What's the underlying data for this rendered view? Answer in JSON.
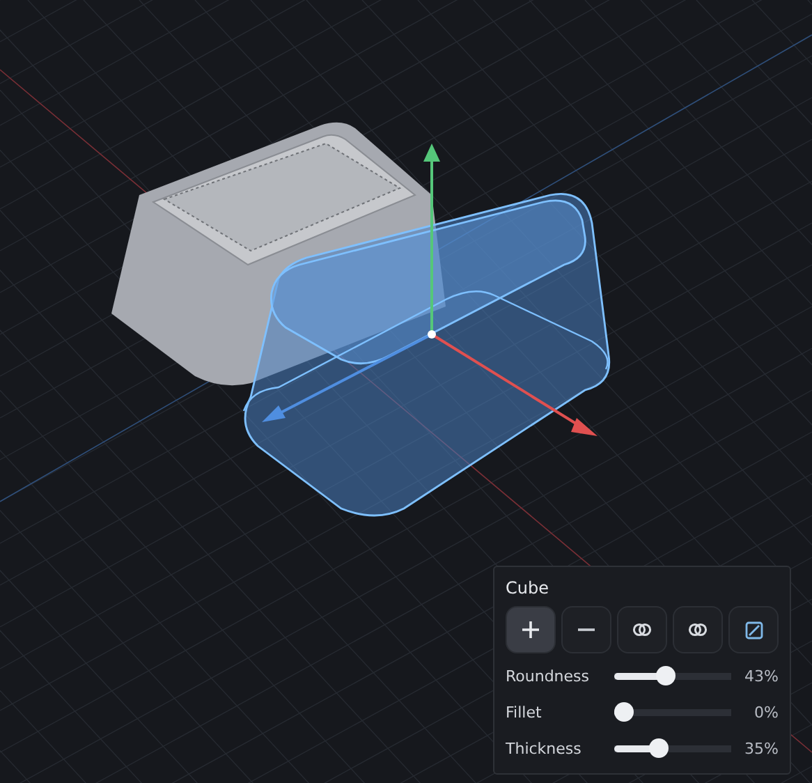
{
  "panel": {
    "title": "Cube",
    "tools": [
      {
        "kind": "add",
        "selected": true
      },
      {
        "kind": "subtract",
        "selected": false
      },
      {
        "kind": "union",
        "selected": false
      },
      {
        "kind": "intersect",
        "selected": false
      },
      {
        "kind": "slice",
        "selected": false
      }
    ],
    "sliders": [
      {
        "label": "Roundness",
        "level": 0.43,
        "reading": "43%"
      },
      {
        "label": "Fillet",
        "level": 0,
        "reading": "0%"
      },
      {
        "label": "Thickness",
        "level": 0.35,
        "reading": "35%"
      }
    ]
  }
}
